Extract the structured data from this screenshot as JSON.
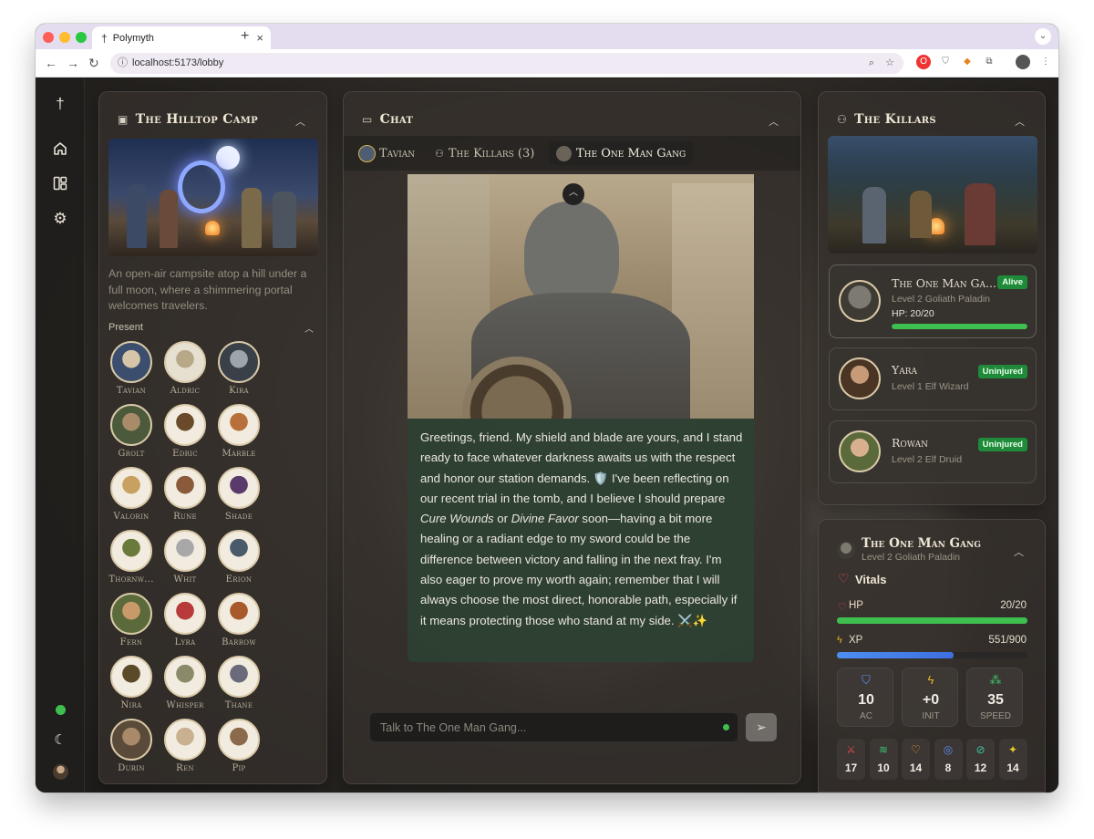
{
  "browser": {
    "tab_title": "Polymyth",
    "url": "localhost:5173/lobby"
  },
  "camp": {
    "title": "The Hilltop Camp",
    "description": "An open-air campsite atop a hill under a full moon, where a shimmering portal welcomes travelers.",
    "present_label": "Present",
    "present": [
      "Tavian",
      "Aldric",
      "Kira",
      "Grolt",
      "Edric",
      "Marble",
      "Valorin",
      "Rune",
      "Shade",
      "Thornw...",
      "Whit",
      "Erion",
      "Fern",
      "Lyra",
      "Barrow",
      "Nira",
      "Whisper",
      "Thane",
      "Durin",
      "Ren",
      "Pip"
    ]
  },
  "chat": {
    "title": "Chat",
    "tabs": [
      "Tavian",
      "The Killars (3)",
      "The One Man Gang"
    ],
    "active_tab": 2,
    "message_parts": {
      "p1": "Greetings, friend. My shield and blade are yours, and I stand ready to face whatever darkness awaits us with the respect and honor our station demands. 🛡️ I've been reflecting on our recent trial in the tomb, and I believe I should prepare ",
      "em1": "Cure Wounds",
      "p2": " or ",
      "em2": "Divine Favor",
      "p3": " soon—having a bit more healing or a radiant edge to my sword could be the difference between victory and falling in the next fray. I'm also eager to prove my worth again; remember that I will always choose the most direct, honorable path, especially if it means protecting those who stand at my side. ⚔️✨"
    },
    "input_placeholder": "Talk to The One Man Gang..."
  },
  "party": {
    "title": "The Killars",
    "members": [
      {
        "name": "The One Man Ga...",
        "subtitle": "Level 2 Goliath Paladin",
        "status": "Alive",
        "hp_text": "HP: 20/20",
        "hp_fraction": 1.0
      },
      {
        "name": "Yara",
        "subtitle": "Level 1 Elf Wizard",
        "status": "Uninjured"
      },
      {
        "name": "Rowan",
        "subtitle": "Level 2 Elf Druid",
        "status": "Uninjured"
      }
    ]
  },
  "character": {
    "name": "The One Man Gang",
    "subtitle": "Level 2 Goliath Paladin",
    "vitals_label": "Vitals",
    "hp_label": "HP",
    "hp_value": "20/20",
    "hp_fraction": 1.0,
    "xp_label": "XP",
    "xp_value": "551/900",
    "xp_fraction": 0.612,
    "stats": [
      {
        "value": "10",
        "label": "AC",
        "icon": "shield-icon",
        "color": "#5b8ef0"
      },
      {
        "value": "+0",
        "label": "INIT",
        "icon": "bolt-icon",
        "color": "#e7b526"
      },
      {
        "value": "35",
        "label": "SPEED",
        "icon": "footprints-icon",
        "color": "#3dc46a"
      }
    ],
    "abilities": [
      {
        "value": "17",
        "icon": "sword-icon",
        "color": "#e5484d"
      },
      {
        "value": "10",
        "icon": "wind-icon",
        "color": "#3dc46a"
      },
      {
        "value": "14",
        "icon": "heart-icon",
        "color": "#f08a30"
      },
      {
        "value": "8",
        "icon": "brain-icon",
        "color": "#5b8ef0"
      },
      {
        "value": "12",
        "icon": "compass-icon",
        "color": "#3dc4a0"
      },
      {
        "value": "14",
        "icon": "sparkles-icon",
        "color": "#e7c726"
      }
    ]
  },
  "colors": {
    "accent_green": "#3fbf4f",
    "xp_blue": "#4d8ef0",
    "badge_green": "#1f8a3a"
  }
}
